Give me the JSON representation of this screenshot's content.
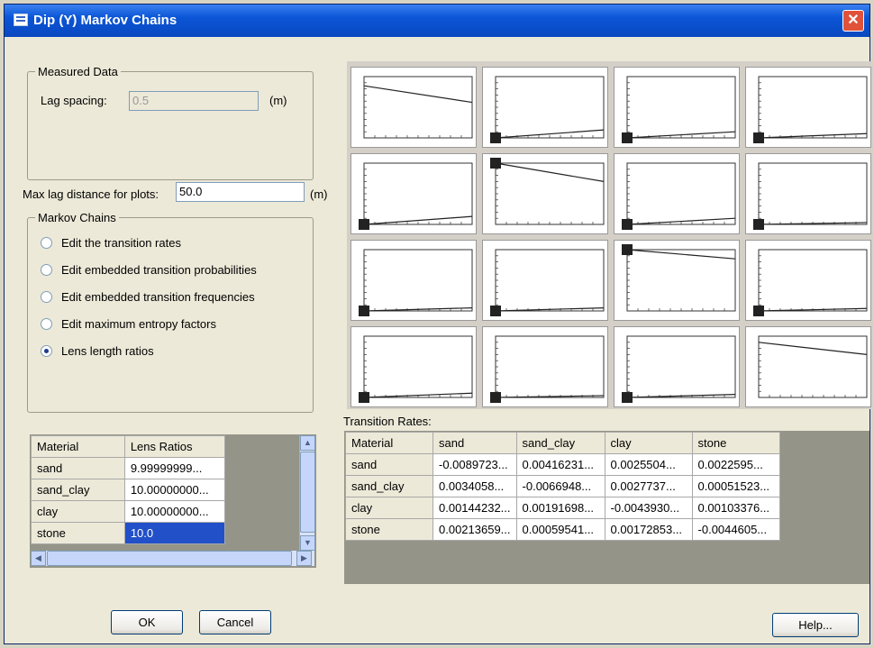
{
  "window": {
    "title": "Dip (Y) Markov Chains",
    "close_label": "✕"
  },
  "measured": {
    "legend": "Measured Data",
    "lag_label": "Lag spacing:",
    "lag_value": "0.5",
    "lag_unit": "(m)"
  },
  "maxlag": {
    "label": "Max lag distance for plots:",
    "value": "50.0",
    "unit": "(m)"
  },
  "markov": {
    "legend": "Markov Chains",
    "options": [
      {
        "label": "Edit the transition rates",
        "checked": false
      },
      {
        "label": "Edit embedded transition probabilities",
        "checked": false
      },
      {
        "label": "Edit embedded transition frequencies",
        "checked": false
      },
      {
        "label": "Edit maximum entropy factors",
        "checked": false
      },
      {
        "label": "Lens length ratios",
        "checked": true
      }
    ]
  },
  "lens_table": {
    "headers": [
      "Material",
      "Lens Ratios"
    ],
    "rows": [
      [
        "sand",
        "9.99999999..."
      ],
      [
        "sand_clay",
        "10.00000000..."
      ],
      [
        "clay",
        "10.00000000..."
      ],
      [
        "stone",
        "10.0"
      ]
    ]
  },
  "transition": {
    "label": "Transition Rates:",
    "headers": [
      "Material",
      "sand",
      "sand_clay",
      "clay",
      "stone"
    ],
    "rows": [
      [
        "sand",
        "-0.0089723...",
        "0.00416231...",
        "0.0025504...",
        "0.0022595..."
      ],
      [
        "sand_clay",
        "0.0034058...",
        "-0.0066948...",
        "0.0027737...",
        "0.00051523..."
      ],
      [
        "clay",
        "0.00144232...",
        "0.00191698...",
        "-0.0043930...",
        "0.00103376..."
      ],
      [
        "stone",
        "0.00213659...",
        "0.00059541...",
        "0.00172853...",
        "-0.0044605..."
      ]
    ]
  },
  "buttons": {
    "ok": "OK",
    "cancel": "Cancel",
    "help": "Help..."
  },
  "icons": {
    "window": "app-icon",
    "close": "close-icon",
    "up": "scroll-up-icon",
    "down": "scroll-down-icon",
    "left": "scroll-left-icon",
    "right": "scroll-right-icon"
  },
  "colors": {
    "title_bar": "#0b55d6",
    "selection": "#2150c8",
    "close": "#e0523a"
  },
  "chart_data": {
    "type": "line",
    "layout": "4x4 grid of transition probability plots",
    "materials": [
      "sand",
      "sand_clay",
      "clay",
      "stone"
    ],
    "xlim": [
      0,
      50
    ],
    "ylim": [
      0,
      1
    ],
    "plots": [
      {
        "row": "sand",
        "col": "sand",
        "start": 0.85,
        "end": 0.58
      },
      {
        "row": "sand",
        "col": "sand_clay",
        "start": 0.0,
        "end": 0.13
      },
      {
        "row": "sand",
        "col": "clay",
        "start": 0.0,
        "end": 0.1
      },
      {
        "row": "sand",
        "col": "stone",
        "start": 0.0,
        "end": 0.07
      },
      {
        "row": "sand_clay",
        "col": "sand",
        "start": 0.0,
        "end": 0.13
      },
      {
        "row": "sand_clay",
        "col": "sand_clay",
        "start": 1.0,
        "end": 0.7
      },
      {
        "row": "sand_clay",
        "col": "clay",
        "start": 0.0,
        "end": 0.1
      },
      {
        "row": "sand_clay",
        "col": "stone",
        "start": 0.0,
        "end": 0.03
      },
      {
        "row": "clay",
        "col": "sand",
        "start": 0.0,
        "end": 0.05
      },
      {
        "row": "clay",
        "col": "sand_clay",
        "start": 0.0,
        "end": 0.05
      },
      {
        "row": "clay",
        "col": "clay",
        "start": 1.0,
        "end": 0.85
      },
      {
        "row": "clay",
        "col": "stone",
        "start": 0.0,
        "end": 0.04
      },
      {
        "row": "stone",
        "col": "sand",
        "start": 0.0,
        "end": 0.07
      },
      {
        "row": "stone",
        "col": "sand_clay",
        "start": 0.0,
        "end": 0.03
      },
      {
        "row": "stone",
        "col": "clay",
        "start": 0.0,
        "end": 0.05
      },
      {
        "row": "stone",
        "col": "stone",
        "start": 0.9,
        "end": 0.7
      }
    ]
  }
}
